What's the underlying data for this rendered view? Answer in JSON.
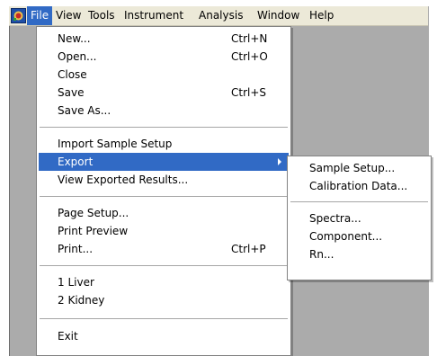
{
  "menubar": {
    "items": [
      "File",
      "View",
      "Tools",
      "Instrument",
      "Analysis",
      "Window",
      "Help"
    ]
  },
  "file_menu": {
    "new": {
      "label": "New...",
      "shortcut": "Ctrl+N"
    },
    "open": {
      "label": "Open...",
      "shortcut": "Ctrl+O"
    },
    "close": {
      "label": "Close"
    },
    "save": {
      "label": "Save",
      "shortcut": "Ctrl+S"
    },
    "save_as": {
      "label": "Save As..."
    },
    "import_sample_setup": {
      "label": "Import Sample Setup"
    },
    "export": {
      "label": "Export"
    },
    "view_exported_results": {
      "label": "View Exported Results..."
    },
    "page_setup": {
      "label": "Page Setup..."
    },
    "print_preview": {
      "label": "Print Preview"
    },
    "print": {
      "label": "Print...",
      "shortcut": "Ctrl+P"
    },
    "recent_1": {
      "label": "1 Liver"
    },
    "recent_2": {
      "label": "2 Kidney"
    },
    "exit": {
      "label": "Exit"
    }
  },
  "export_submenu": {
    "sample_setup": "Sample Setup...",
    "calibration_data": "Calibration Data...",
    "spectra": "Spectra...",
    "component": "Component...",
    "rn": "Rn..."
  },
  "colors": {
    "highlight": "#316ac5",
    "menubar_bg": "#ece9d8",
    "workspace_bg": "#ababab"
  }
}
